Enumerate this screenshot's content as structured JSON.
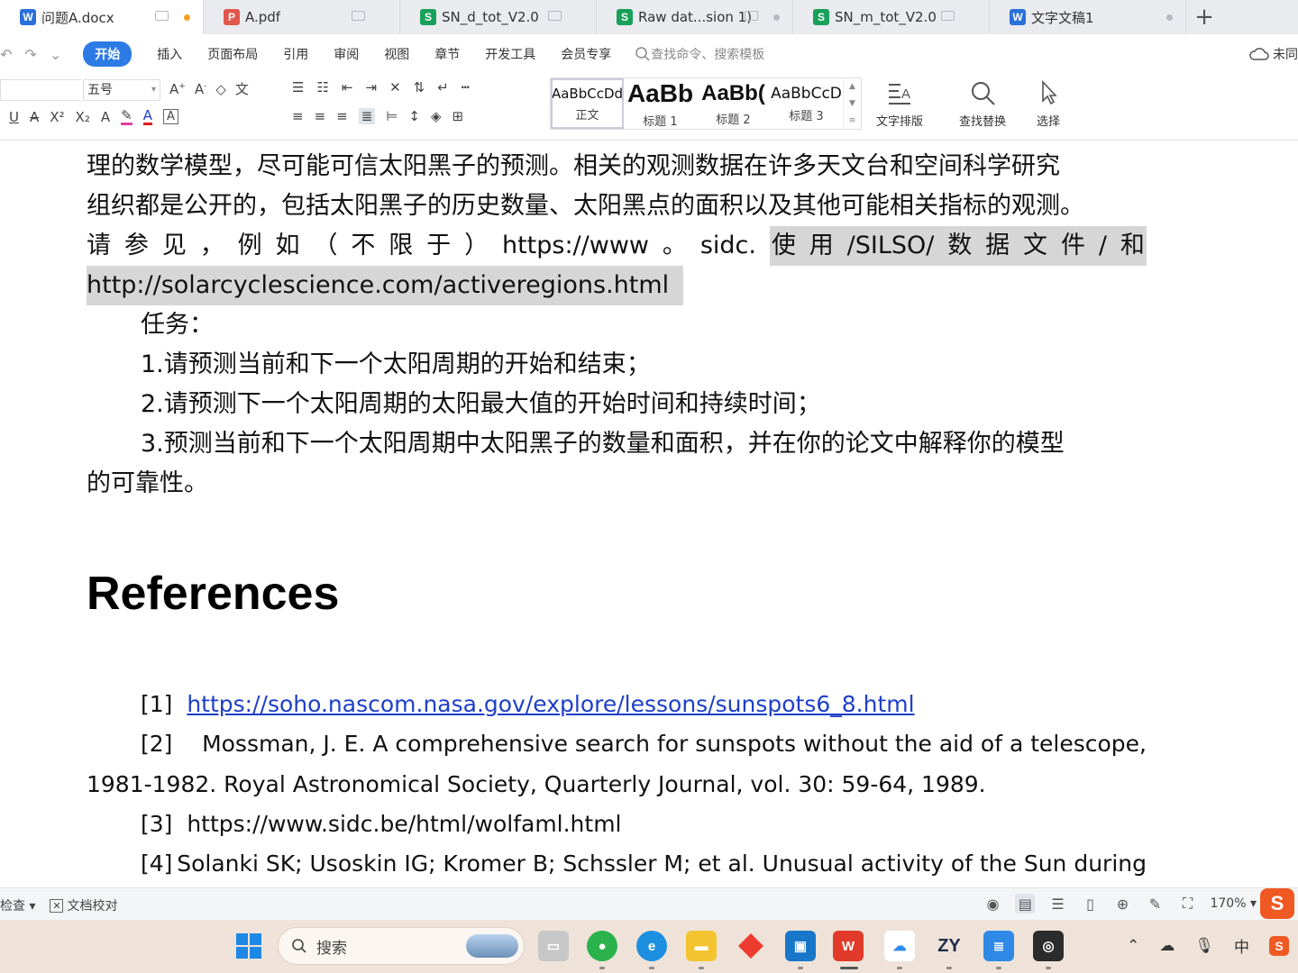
{
  "tabs": [
    {
      "label": "问题A.docx",
      "type": "W",
      "active": true
    },
    {
      "label": "A.pdf",
      "type": "P"
    },
    {
      "label": "SN_d_tot_V2.0",
      "type": "S"
    },
    {
      "label": "Raw dat...sion 1)",
      "type": "S"
    },
    {
      "label": "SN_m_tot_V2.0",
      "type": "S"
    },
    {
      "label": "文字文稿1",
      "type": "W"
    }
  ],
  "tab_add": "+",
  "menu": {
    "items": [
      "开始",
      "插入",
      "页面布局",
      "引用",
      "审阅",
      "视图",
      "章节",
      "开发工具",
      "会员专享"
    ],
    "search_placeholder": "查找命令、搜索模板",
    "cloud_label": "未同"
  },
  "ribbon": {
    "font_size": "五号",
    "styles": [
      {
        "preview": "AaBbCcDd",
        "label": "正文"
      },
      {
        "preview": "AaBb",
        "label": "标题 1"
      },
      {
        "preview": "AaBb(",
        "label": "标题 2"
      },
      {
        "preview": "AaBbCcD",
        "label": "标题 3"
      }
    ],
    "text_layout": "文字排版",
    "find_replace": "查找替换",
    "select": "选择"
  },
  "document": {
    "para_line1": "理的数学模型，尽可能可信太阳黑子的预测。相关的观测数据在许多天文台和空间科学研究",
    "para_line2": "组织都是公开的，包括太阳黑子的历史数量、太阳黑点的面积以及其他可能相关指标的观测。",
    "para_line3_parts": [
      "请",
      "参",
      "见",
      "，",
      "例",
      "如",
      "（",
      "不",
      "限",
      "于",
      "）",
      "https://www",
      "。",
      "sidc."
    ],
    "para_line3_hl_parts": [
      "使",
      "用",
      "/SILSO/",
      "数",
      "据",
      "文",
      "件",
      "/",
      "和"
    ],
    "para_line4": "http://solarcyclescience.com/activeregions.html",
    "task_title": "任务：",
    "task1": "1.请预测当前和下一个太阳周期的开始和结束；",
    "task2": "2.请预测下一个太阳周期的太阳最大值的开始时间和持续时间；",
    "task3_line1": "3.预测当前和下一个太阳周期中太阳黑子的数量和面积，并在你的论文中解释你的模型",
    "task3_line2": "的可靠性。",
    "heading": "References",
    "ref1_num": "[1]",
    "ref1_link": "https://soho.nascom.nasa.gov/explore/lessons/sunspots6_8.html",
    "ref2_num": "[2]",
    "ref2_line1": "Mossman, J. E. A comprehensive search for sunspots without the aid of a telescope,",
    "ref2_line2": "1981-1982. Royal Astronomical Society, Quarterly Journal, vol. 30: 59-64, 1989.",
    "ref3_num": "[3]",
    "ref3_text": "https://www.sidc.be/html/wolfaml.html",
    "ref4_num": "[4]",
    "ref4_text": "Solanki SK; Usoskin IG; Kromer B; Schssler M; et al. Unusual activity of the Sun during"
  },
  "statusbar": {
    "check": "检查",
    "proofread": "文档校对",
    "zoom": "170%"
  },
  "taskbar": {
    "search_label": "搜索",
    "ime": "中",
    "apps": [
      "windows-start",
      "file-explorer-gray",
      "wechat",
      "edge",
      "folder",
      "red-app",
      "blue-app",
      "wps",
      "baidu-netdisk",
      "zy",
      "notepad",
      "capture"
    ]
  },
  "colors": {
    "accent": "#2c7be5",
    "link": "#1d3fc8",
    "highlight": "#d6d6d6"
  }
}
